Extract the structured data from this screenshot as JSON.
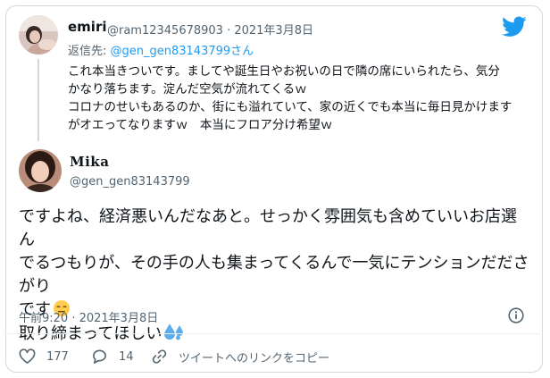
{
  "colors": {
    "accent": "#1d9bf0",
    "secondary_text": "#536471",
    "border": "#cfd9de"
  },
  "icons": [
    "twitter-logo-icon",
    "heart-icon",
    "reply-icon",
    "link-icon",
    "info-icon",
    "expressionless-face-emoji",
    "sweat-droplets-emoji"
  ],
  "parent_tweet": {
    "display_name": "emiri",
    "handle_and_date": "@ram12345678903 · 2021年3月8日",
    "reply_prefix": "返信先: ",
    "reply_mention": "@gen_gen83143799さん",
    "text": "これ本当きついです。ましてや誕生日やお祝いの日で隣の席にいられたら、気分\nかなり落ちます。淀んだ空気が流れてくるｗ\nコロナのせいもあるのか、街にも溢れていて、家の近くでも本当に毎日見かけます\nがオエってなりますｗ　本当にフロア分け希望ｗ"
  },
  "main_tweet": {
    "display_name": "𝐌𝐢𝐤𝐚",
    "handle": "@gen_gen83143799",
    "text_line1": "ですよね、経済悪いんだなあと。せっかく雰囲気も含めていいお店選ん",
    "text_line2": "でるつもりが、その手の人も集まってくるんで一気にテンションだださがり",
    "text_line3": "です",
    "text_line4": "取り締まってほしい",
    "timestamp": "午前9:20 · 2021年3月8日"
  },
  "actions": {
    "like_count": "177",
    "reply_count": "14",
    "copy_link_label": "ツイートへのリンクをコピー"
  }
}
